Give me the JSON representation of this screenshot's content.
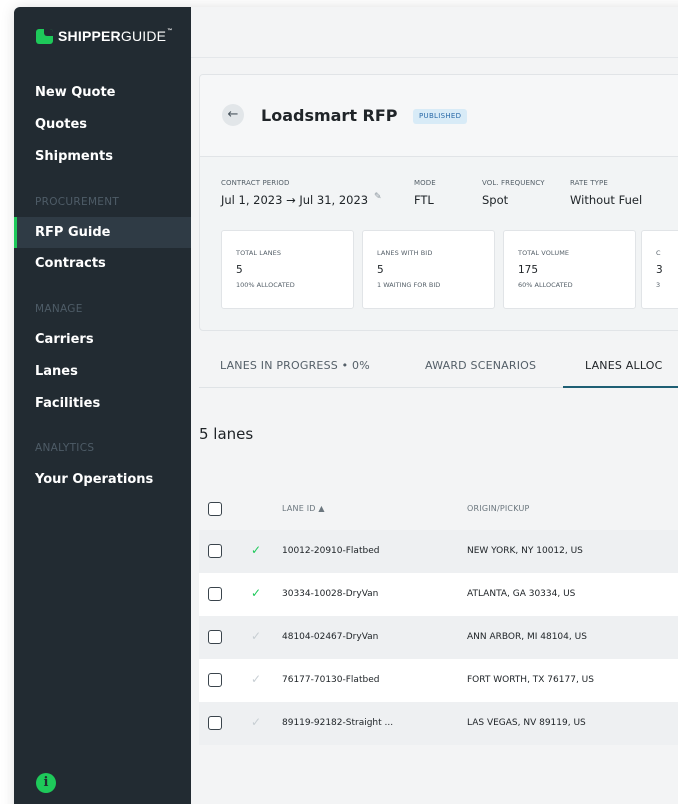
{
  "brand": {
    "name_bold": "SHIPPER",
    "name_thin": "GUIDE",
    "tm": "™"
  },
  "sidebar": {
    "items": [
      {
        "label": "New Quote"
      },
      {
        "label": "Quotes"
      },
      {
        "label": "Shipments"
      }
    ],
    "procurement_label": "PROCUREMENT",
    "procurement_items": [
      {
        "label": "RFP Guide",
        "active": true
      },
      {
        "label": "Contracts"
      }
    ],
    "manage_label": "MANAGE",
    "manage_items": [
      {
        "label": "Carriers"
      },
      {
        "label": "Lanes"
      },
      {
        "label": "Facilities"
      }
    ],
    "analytics_label": "ANALYTICS",
    "analytics_items": [
      {
        "label": "Your Operations"
      }
    ],
    "info_icon": "i"
  },
  "rfp": {
    "back_icon": "←",
    "title": "Loadsmart RFP",
    "status": "PUBLISHED",
    "meta": {
      "contract_period_label": "CONTRACT PERIOD",
      "contract_period_value": "Jul 1, 2023 → Jul 31, 2023",
      "mode_label": "MODE",
      "mode_value": "FTL",
      "frequency_label": "VOL. FREQUENCY",
      "frequency_value": "Spot",
      "rate_type_label": "RATE TYPE",
      "rate_type_value": "Without Fuel"
    },
    "stats": [
      {
        "label": "TOTAL LANES",
        "value": "5",
        "sub": "100% ALLOCATED"
      },
      {
        "label": "LANES WITH BID",
        "value": "5",
        "sub": "1 WAITING FOR BID"
      },
      {
        "label": "TOTAL VOLUME",
        "value": "175",
        "sub": "60% ALLOCATED"
      },
      {
        "label": "C",
        "value": "3",
        "sub": "3"
      }
    ]
  },
  "tabs": [
    {
      "label": "LANES IN PROGRESS  •  0%"
    },
    {
      "label": "AWARD SCENARIOS"
    },
    {
      "label": "LANES ALLOC",
      "active": true
    }
  ],
  "lanes_count": "5 lanes",
  "table": {
    "columns": {
      "lane_id": "LANE ID ▲",
      "origin": "ORIGIN/PICKUP"
    },
    "rows": [
      {
        "lane_id": "10012-20910-Flatbed",
        "origin": "NEW YORK, NY 10012, US",
        "allocated": true
      },
      {
        "lane_id": "30334-10028-DryVan",
        "origin": "ATLANTA, GA 30334, US",
        "allocated": true
      },
      {
        "lane_id": "48104-02467-DryVan",
        "origin": "ANN ARBOR, MI 48104, US",
        "allocated": false
      },
      {
        "lane_id": "76177-70130-Flatbed",
        "origin": "FORT WORTH, TX 76177, US",
        "allocated": false
      },
      {
        "lane_id": "89119-92182-Straight ...",
        "origin": "LAS VEGAS, NV 89119, US",
        "allocated": false
      }
    ]
  },
  "colors": {
    "sidebar": "#222b32",
    "accent_green": "#1ec95a",
    "tab_underline": "#1e5f74",
    "badge_bg": "#d8ebf7"
  }
}
